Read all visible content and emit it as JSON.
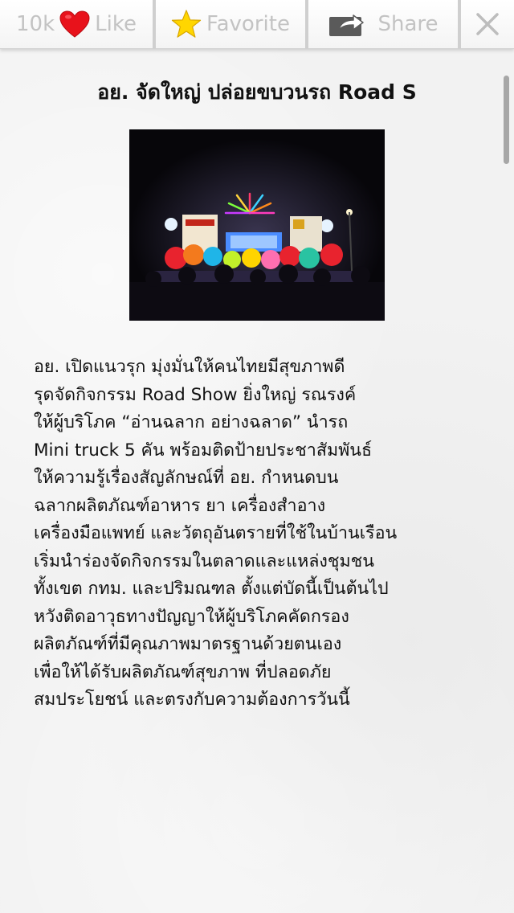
{
  "toolbar": {
    "like_count": "10k",
    "like_label": "Like",
    "favorite_label": "Favorite",
    "share_label": "Share"
  },
  "article": {
    "title": "อย. จัดใหญ่ ปล่อยขบวนรถ Road S",
    "lines": [
      " อย. เปิดแนวรุก มุ่งมั่นให้คนไทยมีสุขภาพดี",
      "รุดจัดกิจกรรม Road Show ยิ่งใหญ่ รณรงค์",
      "ให้ผู้บริโภค “อ่านฉลาก อย่างฉลาด” นำรถ",
      "Mini truck 5 คัน พร้อมติดป้ายประชาสัมพันธ์",
      "ให้ความรู้เรื่องสัญลักษณ์ที่ อย. กำหนดบน",
      "ฉลากผลิตภัณฑ์อาหาร ยา เครื่องสำอาง",
      "เครื่องมือแพทย์ และวัตถุอันตรายที่ใช้ในบ้านเรือน",
      "เริ่มนำร่องจัดกิจกรรมในตลาดและแหล่งชุมชน",
      "ทั้งเขต กทม. และปริมณฑล ตั้งแต่บัดนี้เป็นต้นไป",
      "หวังติดอาวุธทางปัญญาให้ผู้บริโภคคัดกรอง",
      "ผลิตภัณฑ์ที่มีคุณภาพมาตรฐานด้วยตนเอง",
      "เพื่อให้ได้รับผลิตภัณฑ์สุขภาพ ที่ปลอดภัย",
      "สมประโยชน์ และตรงกับความต้องการวันนี้"
    ]
  },
  "icons": {
    "like": "heart-icon",
    "favorite": "star-icon",
    "share": "share-arrow-icon",
    "close": "close-icon"
  },
  "colors": {
    "heart": "#e8121b",
    "star": "#ffd600",
    "toolbar_text": "#c3c3c3",
    "share_icon": "#5a5a5a"
  }
}
